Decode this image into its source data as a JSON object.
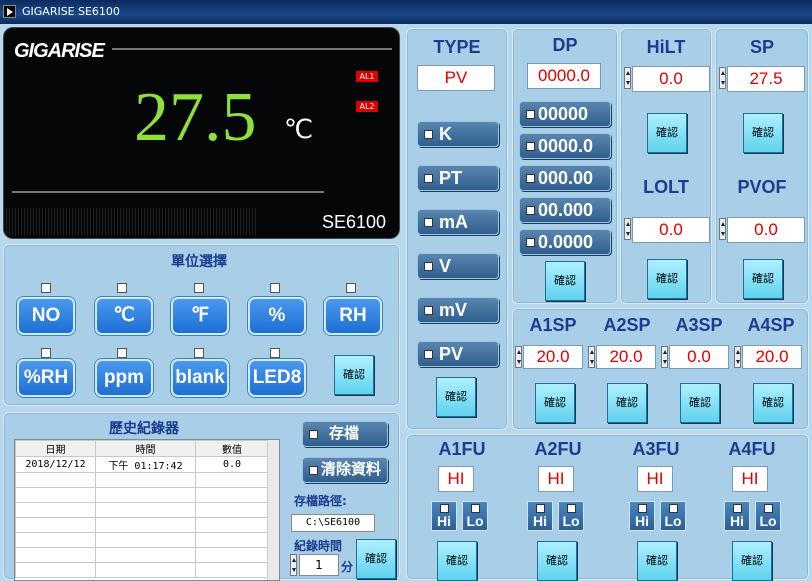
{
  "window": {
    "brand": "GIGARISE",
    "model": "SE6100"
  },
  "display": {
    "logo": "GIGARISE",
    "reading": "27.5",
    "unit": "℃",
    "alarm1": "AL1",
    "alarm2": "AL2",
    "model": "SE6100"
  },
  "units": {
    "title": "單位選擇",
    "items": [
      "NO",
      "℃",
      "℉",
      "%",
      "RH",
      "%RH",
      "ppm",
      "blank",
      "LED8"
    ],
    "confirm": "確認"
  },
  "logger": {
    "title": "歷史紀錄器",
    "columns": [
      "日期",
      "時間",
      "數值"
    ],
    "rows": [
      [
        "2018/12/12",
        "下午 01:17:42",
        "0.0"
      ]
    ],
    "save_label": "存檔",
    "clear_label": "清除資料",
    "path_label": "存檔路徑:",
    "path_value": "C:\\SE6100",
    "interval_label": "紀錄時間",
    "interval_value": "1",
    "interval_unit": "分",
    "confirm": "確認"
  },
  "type": {
    "title": "TYPE",
    "value": "PV",
    "options": [
      "K",
      "PT",
      "mA",
      "V",
      "mV",
      "PV"
    ],
    "confirm": "確認"
  },
  "dp": {
    "title": "DP",
    "value": "0000.0",
    "options": [
      "00000",
      "0000.0",
      "000.00",
      "00.000",
      "0.0000"
    ],
    "confirm": "確認"
  },
  "hilt": {
    "title": "HiLT",
    "value": "0.0",
    "confirm": "確認"
  },
  "sp": {
    "title": "SP",
    "value": "27.5",
    "confirm": "確認"
  },
  "lolt": {
    "title": "LOLT",
    "value": "0.0",
    "confirm": "確認"
  },
  "pvof": {
    "title": "PVOF",
    "value": "0.0",
    "confirm": "確認"
  },
  "alarmsp": {
    "items": [
      {
        "title": "A1SP",
        "value": "20.0",
        "confirm": "確認"
      },
      {
        "title": "A2SP",
        "value": "20.0",
        "confirm": "確認"
      },
      {
        "title": "A3SP",
        "value": "0.0",
        "confirm": "確認"
      },
      {
        "title": "A4SP",
        "value": "20.0",
        "confirm": "確認"
      }
    ]
  },
  "alarmfu": {
    "items": [
      {
        "title": "A1FU",
        "value": "HI",
        "hi": "Hi",
        "lo": "Lo",
        "confirm": "確認"
      },
      {
        "title": "A2FU",
        "value": "HI",
        "hi": "Hi",
        "lo": "Lo",
        "confirm": "確認"
      },
      {
        "title": "A3FU",
        "value": "HI",
        "hi": "Hi",
        "lo": "Lo",
        "confirm": "確認"
      },
      {
        "title": "A4FU",
        "value": "HI",
        "hi": "Hi",
        "lo": "Lo",
        "confirm": "確認"
      }
    ]
  },
  "colors": {
    "accent": "#1a3d8f",
    "value_text": "#e00000",
    "reading": "#8fe03a"
  }
}
